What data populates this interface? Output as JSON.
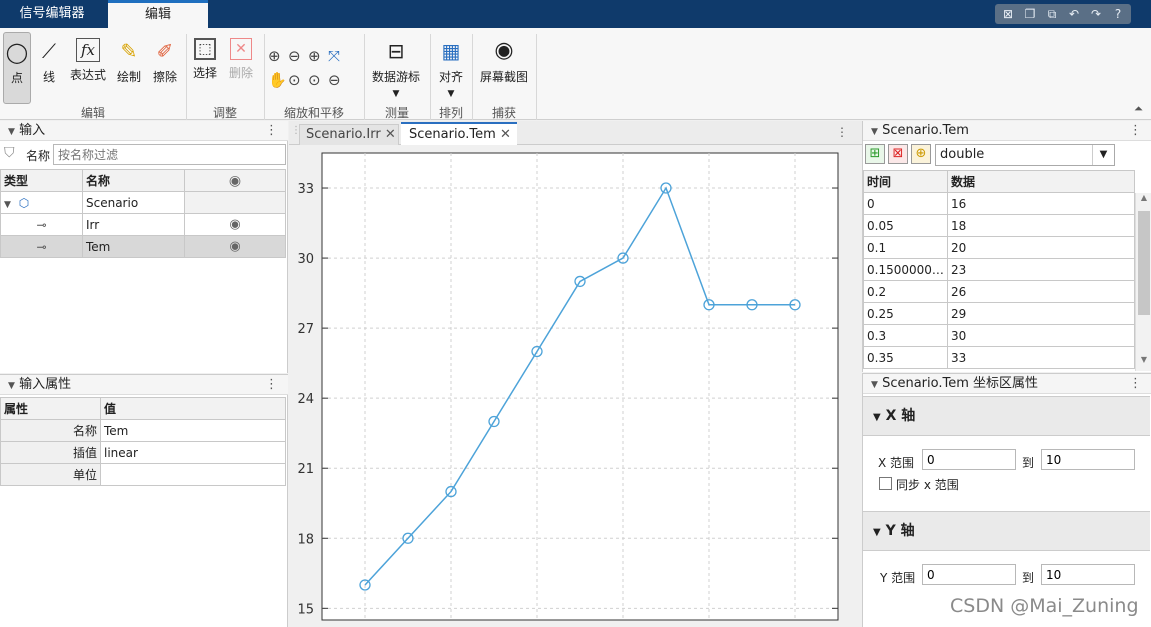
{
  "tabs": [
    "信号编辑器",
    "编辑"
  ],
  "quick_access": [
    "⊠",
    "❐",
    "⧉",
    "↶",
    "↷",
    "?"
  ],
  "ribbon": {
    "buttons": [
      {
        "label": "点",
        "icon": "◯"
      },
      {
        "label": "线",
        "icon": "⟋"
      },
      {
        "label": "表达式",
        "icon": "fx"
      },
      {
        "label": "绘制",
        "icon": "✎"
      },
      {
        "label": "擦除",
        "icon": "✐"
      },
      {
        "label": "选择",
        "icon": "⬚"
      },
      {
        "label": "删除",
        "icon": "✕"
      },
      {
        "label": "数据游标",
        "icon": "⊟"
      },
      {
        "label": "对齐",
        "icon": "▦"
      },
      {
        "label": "屏幕截图",
        "icon": "◉"
      }
    ],
    "zoom_icons": [
      "⊕",
      "⊖",
      "⊕",
      "⤧",
      "✋",
      "⊙",
      "⊙",
      "⊖"
    ],
    "groups": [
      "编辑",
      "调整",
      "缩放和平移",
      "测量",
      "排列",
      "捕获"
    ]
  },
  "inputs": {
    "title": "输入",
    "filter_label": "名称",
    "filter_placeholder": "按名称过滤",
    "headers": [
      "类型",
      "名称",
      ""
    ],
    "rows": [
      [
        "Scenario"
      ],
      [
        "Irr"
      ],
      [
        "Tem"
      ]
    ]
  },
  "props": {
    "title": "输入属性",
    "headers": [
      "属性",
      "值"
    ],
    "rows": [
      [
        "名称",
        "Tem"
      ],
      [
        "插值",
        "linear"
      ],
      [
        "单位",
        ""
      ]
    ]
  },
  "doc_tabs": [
    "Scenario.Irr",
    "Scenario.Tem"
  ],
  "chart_data": {
    "type": "line",
    "x": [
      0,
      0.05,
      0.1,
      0.15,
      0.2,
      0.25,
      0.3,
      0.35,
      0.4,
      0.45,
      0.5
    ],
    "y": [
      16,
      18,
      20,
      23,
      26,
      29,
      30,
      33,
      28,
      28,
      28
    ],
    "ylim": [
      14.5,
      34.5
    ],
    "xlim": [
      -0.05,
      0.55
    ],
    "yticks": [
      15,
      18,
      21,
      24,
      27,
      30,
      33
    ],
    "line_color": "#4da3d9",
    "grid": true
  },
  "data_panel": {
    "title": "Scenario.Tem",
    "type_value": "double",
    "headers": [
      "时间",
      "数据"
    ],
    "rows": [
      [
        "0",
        "16"
      ],
      [
        "0.05",
        "18"
      ],
      [
        "0.1",
        "20"
      ],
      [
        "0.15000000...",
        "23"
      ],
      [
        "0.2",
        "26"
      ],
      [
        "0.25",
        "29"
      ],
      [
        "0.3",
        "30"
      ],
      [
        "0.35",
        "33"
      ]
    ]
  },
  "axes_panel": {
    "title": "Scenario.Tem 坐标区属性",
    "x_section": "X 轴",
    "x_range_label": "X 范围",
    "x_from": "0",
    "to_label": "到",
    "x_to": "10",
    "sync_label": "同步 x 范围",
    "y_section": "Y 轴",
    "y_range_label": "Y 范围",
    "y_from": "0",
    "y_to": "10"
  },
  "watermark": "CSDN @Mai_Zuning"
}
